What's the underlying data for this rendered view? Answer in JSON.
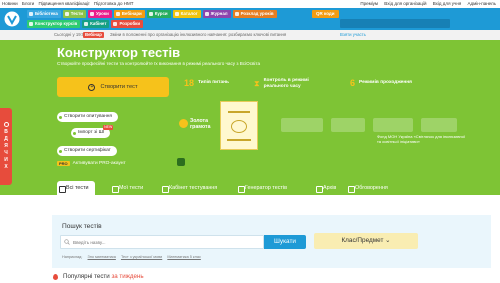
{
  "topbar": {
    "links": [
      "Новини",
      "Блоги",
      "Підвищення кваліфікації",
      "Підготовка до НМТ"
    ],
    "right": [
      "Преміум",
      "Вхід для організацій",
      "Вхід для учня",
      "Адмін-панель"
    ]
  },
  "nav": {
    "chips": [
      {
        "label": "Бібліотека",
        "color": "#3aa7e0"
      },
      {
        "label": "Тести",
        "color": "#8bc34a"
      },
      {
        "label": "Уроки",
        "color": "#e91e8c"
      },
      {
        "label": "Вебінари",
        "color": "#f39c12"
      },
      {
        "label": "Курси",
        "color": "#27ae60"
      },
      {
        "label": "Каталог",
        "color": "#f1c40f"
      },
      {
        "label": "Журнал",
        "color": "#8e44ad"
      },
      {
        "label": "Розклад уроків",
        "color": "#e67e22"
      },
      {
        "label": "Конструктор курсів",
        "color": "#2ecc71"
      },
      {
        "label": "Кабінет",
        "color": "#16a085"
      },
      {
        "label": "Розробки",
        "color": "#e74c3c"
      }
    ],
    "qr_label": "QR коди"
  },
  "infobar": {
    "date": "Сьогодні у 19:00",
    "badge": "Вебінар",
    "message": "Зміни в положенні про організацію інклюзивного навчання: розбираємо ключові питання",
    "link": "Взяти участь"
  },
  "hero": {
    "title": "Конструктор тестів",
    "subtitle": "Створюйте професійні тести та контролюйте їх виконання в режимі реального часу з ВсіОсвіта",
    "create_label": "Створити тест",
    "stats": [
      {
        "value": "18",
        "label1": "Типів",
        "label2": "питань"
      },
      {
        "value": "",
        "label1": "Контроль в режимі",
        "label2": "реального часу"
      },
      {
        "value": "6",
        "label1": "Режимів",
        "label2": "проходження"
      }
    ],
    "pills": {
      "survey": "Створити опитування",
      "import": "Імпорт зі ШІ",
      "import_tag": "NEW",
      "certificate": "Створити сертифікат"
    },
    "pro_badge": "PRO",
    "pro_text": "Активувати PRO-акаунт",
    "gold_label": "Золота грамота",
    "partner_caption": "Фонд МОН Україна «Світлячок для інклюзивної та освітньої ініціативи»"
  },
  "tabs": [
    "Всі тести",
    "Мої тести",
    "Кабінет тестування",
    "Генератор тестів",
    "Архів",
    "Обговорення"
  ],
  "search": {
    "title": "Пошук тестів",
    "placeholder": "Введіть назву...",
    "button": "Шукати",
    "class_label": "Клас/Предмет",
    "hints_prefix": "Наприклад:",
    "hints": [
      "Зно математика",
      "Тест з української мови",
      "Математика 5 клас"
    ]
  },
  "popular": {
    "text": "Популярні тести",
    "highlight": "за тиждень"
  },
  "sidetab": {
    "letters": [
      "В",
      "Д",
      "Я",
      "Ч",
      "И",
      "Х"
    ]
  }
}
